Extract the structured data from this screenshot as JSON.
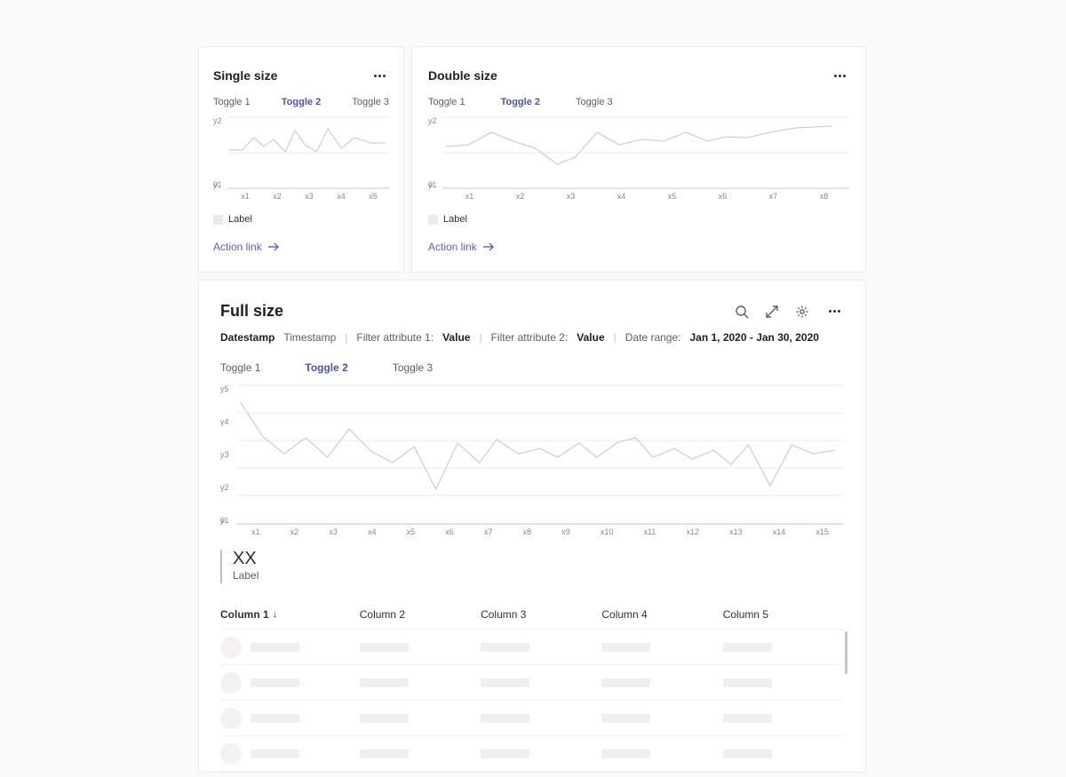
{
  "cards": {
    "single": {
      "title": "Single size",
      "toggles": [
        "Toggle 1",
        "Toggle 2",
        "Toggle 3"
      ],
      "active_toggle": 1,
      "y_ticks": [
        "y2",
        "y1"
      ],
      "zero": "0",
      "x_ticks": [
        "x1",
        "x2",
        "x3",
        "x4",
        "x5"
      ],
      "legend": "Label",
      "action": "Action link"
    },
    "double": {
      "title": "Double size",
      "toggles": [
        "Toggle 1",
        "Toggle 2",
        "Toggle 3"
      ],
      "active_toggle": 1,
      "y_ticks": [
        "y2",
        "y1"
      ],
      "zero": "0",
      "x_ticks": [
        "x1",
        "x2",
        "x3",
        "x4",
        "x5",
        "x6",
        "x7",
        "x8"
      ],
      "legend": "Label",
      "action": "Action link"
    },
    "full": {
      "title": "Full size",
      "filters": {
        "datestamp": "Datestamp",
        "timestamp": "Timestamp",
        "f1_label": "Filter attribute 1:",
        "f1_value": "Value",
        "f2_label": "Filter attribute 2:",
        "f2_value": "Value",
        "dr_label": "Date range:",
        "dr_value": "Jan 1, 2020 - Jan 30, 2020"
      },
      "toggles": [
        "Toggle 1",
        "Toggle 2",
        "Toggle 3"
      ],
      "active_toggle": 1,
      "y_ticks": [
        "y5",
        "y4",
        "y3",
        "y2",
        "y1"
      ],
      "zero": "0",
      "x_ticks": [
        "x1",
        "x2",
        "x3",
        "x4",
        "x5",
        "x6",
        "x7",
        "x8",
        "x9",
        "x10",
        "x11",
        "x12",
        "x13",
        "x14",
        "x15"
      ],
      "stat": {
        "value": "XX",
        "label": "Label"
      },
      "columns": [
        "Column 1",
        "Column 2",
        "Column 3",
        "Column 4",
        "Column 5"
      ]
    }
  },
  "chart_data": [
    {
      "type": "line",
      "title": "Single size",
      "x": [
        "x1",
        "x2",
        "x3",
        "x4",
        "x5"
      ],
      "y_ticks": [
        "0",
        "y1",
        "y2"
      ],
      "series": [
        {
          "name": "Label",
          "values": [
            1.2,
            1.2,
            1.7,
            1.3,
            1.55,
            1.2,
            1.75,
            1.4,
            1.2,
            1.8,
            1.3,
            1.6,
            1.45
          ]
        }
      ],
      "note": "values are approximate heights on a 0–2 scale read from the sparkline; x has 5 tick labels but ~13 sampled points"
    },
    {
      "type": "line",
      "title": "Double size",
      "x": [
        "x1",
        "x2",
        "x3",
        "x4",
        "x5",
        "x6",
        "x7",
        "x8"
      ],
      "y_ticks": [
        "0",
        "y1",
        "y2"
      ],
      "series": [
        {
          "name": "Label",
          "values": [
            1.35,
            1.4,
            1.7,
            1.5,
            1.3,
            0.9,
            1.1,
            1.7,
            1.4,
            1.55,
            1.5,
            1.7,
            1.5,
            1.62,
            1.6,
            1.7,
            1.78,
            1.8
          ]
        }
      ],
      "note": "approximate 0–2 scale"
    },
    {
      "type": "line",
      "title": "Full size",
      "x": [
        "x1",
        "x2",
        "x3",
        "x4",
        "x5",
        "x6",
        "x7",
        "x8",
        "x9",
        "x10",
        "x11",
        "x12",
        "x13",
        "x14",
        "x15"
      ],
      "y_ticks": [
        "0",
        "y1",
        "y2",
        "y3",
        "y4",
        "y5"
      ],
      "series": [
        {
          "name": "Label",
          "values": [
            4.3,
            3.1,
            2.5,
            3.1,
            2.4,
            3.4,
            2.6,
            1.2,
            2.9,
            2.2,
            3.0,
            2.5,
            2.7,
            2.4,
            2.8,
            2.3,
            2.8,
            2.4,
            3.0,
            2.4,
            2.7,
            2.3,
            2.6,
            2.1,
            2.8,
            1.4,
            2.8,
            2.5,
            2.6,
            2.5
          ]
        }
      ],
      "note": "approximate 0–5 scale"
    }
  ]
}
